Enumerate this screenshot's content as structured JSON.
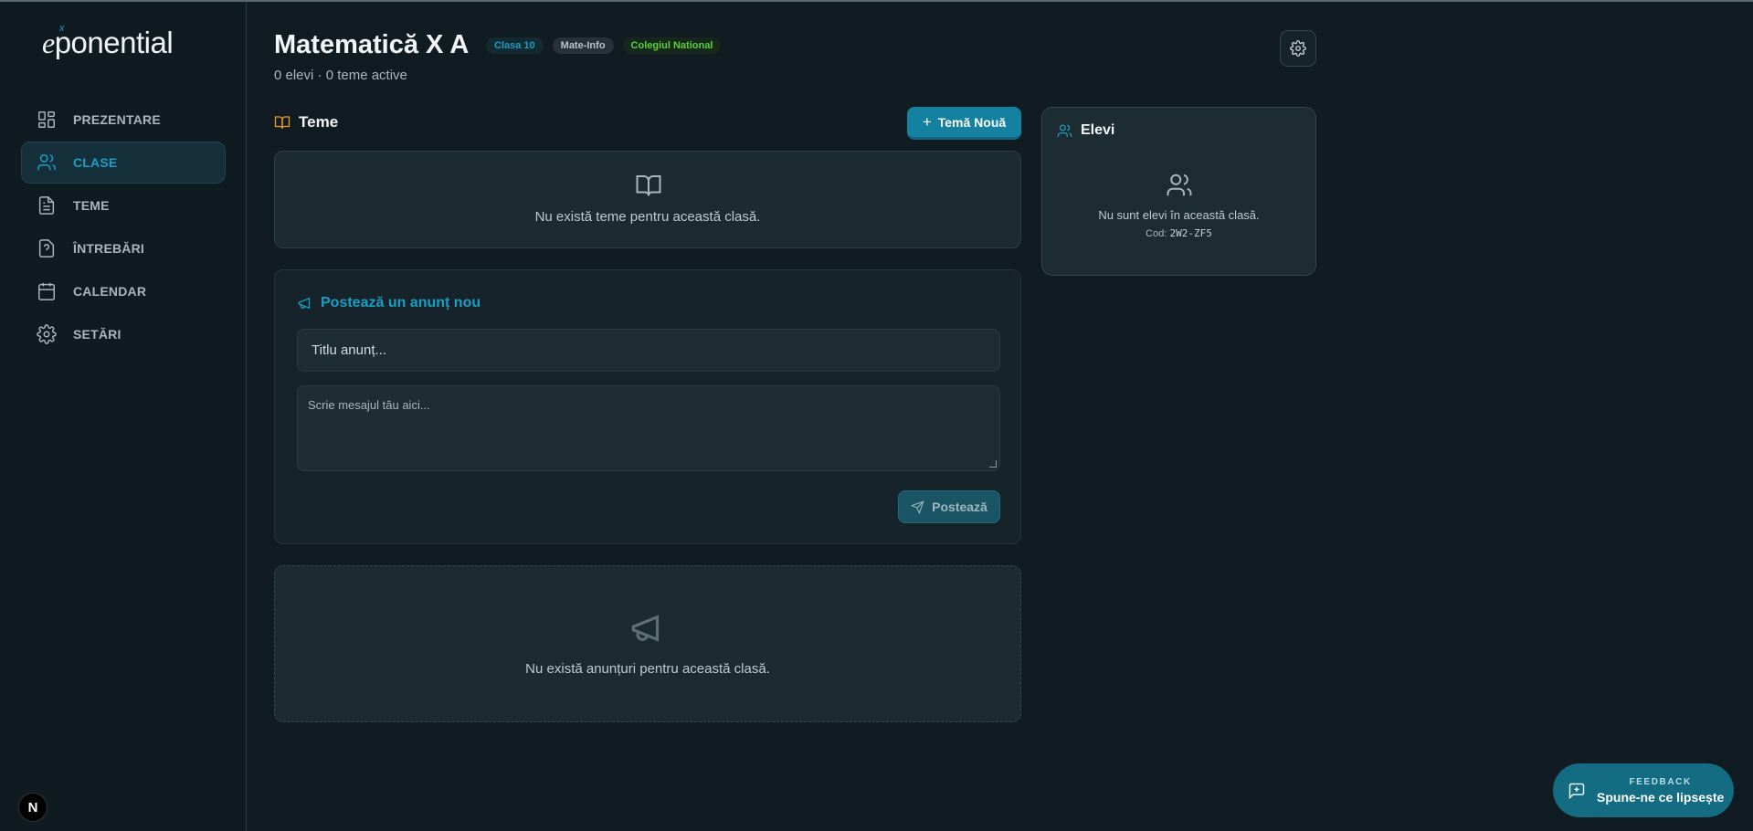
{
  "app": {
    "logo_e": "e",
    "logo_x": "x",
    "logo_rest": "ponential"
  },
  "sidebar": {
    "items": [
      {
        "label": "PREZENTARE",
        "icon": "dashboard-icon",
        "active": false
      },
      {
        "label": "CLASE",
        "icon": "users-icon",
        "active": true
      },
      {
        "label": "TEME",
        "icon": "document-icon",
        "active": false
      },
      {
        "label": "ÎNTREBĂRI",
        "icon": "question-icon",
        "active": false
      },
      {
        "label": "CALENDAR",
        "icon": "calendar-icon",
        "active": false
      },
      {
        "label": "SETĂRI",
        "icon": "gear-icon",
        "active": false
      }
    ],
    "nx_badge": "N"
  },
  "header": {
    "title": "Matematică X A",
    "tags": [
      "Clasa 10",
      "Mate-Info",
      "Colegiul National"
    ],
    "subtitle": "0 elevi · 0 teme active"
  },
  "teme": {
    "heading": "Teme",
    "new_button": "Temă Nouă",
    "empty_message": "Nu există teme pentru această clasă."
  },
  "announce_form": {
    "heading": "Postează un anunț nou",
    "title_placeholder": "Titlu anunț...",
    "message_placeholder": "Scrie mesajul tău aici...",
    "post_button": "Postează"
  },
  "announcements": {
    "empty_message": "Nu există anunțuri pentru această clasă."
  },
  "elevi": {
    "heading": "Elevi",
    "empty_message": "Nu sunt elevi în această clasă.",
    "code_label": "Cod:",
    "code_value": "2W2-ZF5"
  },
  "feedback": {
    "small": "FEEDBACK",
    "big": "Spune-ne ce lipsește"
  },
  "colors": {
    "accent": "#1a9fc2",
    "background": "#111c22",
    "teme_icon": "#e89a2a",
    "tag_green": "#5ad136"
  }
}
